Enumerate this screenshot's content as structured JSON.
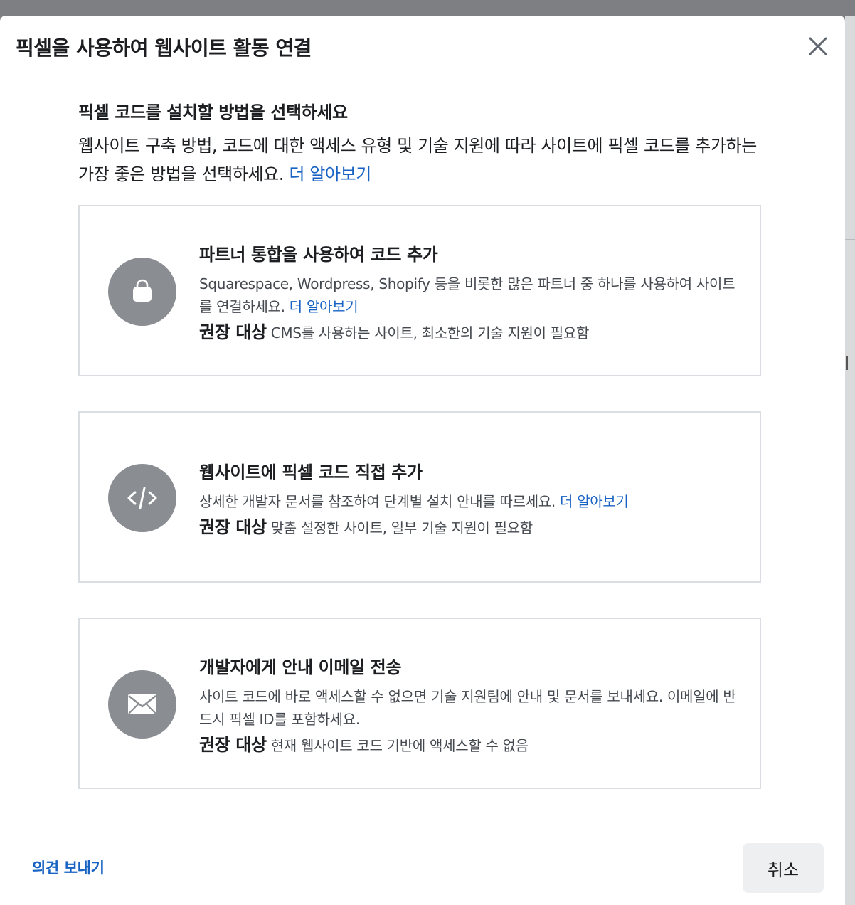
{
  "dialog": {
    "title": "픽셀을 사용하여 웹사이트 활동 연결",
    "close_icon": "close-icon"
  },
  "intro": {
    "heading": "픽셀 코드를 설치할 방법을 선택하세요",
    "description": "웹사이트 구축 방법, 코드에 대한 액세스 유형 및 기술 지원에 따라 사이트에 픽셀 코드를 추가하는 가장 좋은 방법을 선택하세요.",
    "learn_more": "더 알아보기"
  },
  "options": [
    {
      "icon": "shopping-bag-icon",
      "title": "파트너 통합을 사용하여 코드 추가",
      "description": "Squarespace, Wordpress, Shopify 등을 비롯한 많은 파트너 중 하나를 사용하여 사이트를 연결하세요.",
      "learn_more": "더 알아보기",
      "reco_label": "권장 대상",
      "reco_text": "CMS를 사용하는 사이트, 최소한의 기술 지원이 필요함"
    },
    {
      "icon": "code-icon",
      "title": "웹사이트에 픽셀 코드 직접 추가",
      "description": "상세한 개발자 문서를 참조하여 단계별 설치 안내를 따르세요.",
      "learn_more": "더 알아보기",
      "reco_label": "권장 대상",
      "reco_text": "맞춤 설정한 사이트, 일부 기술 지원이 필요함"
    },
    {
      "icon": "envelope-icon",
      "title": "개발자에게 안내 이메일 전송",
      "description": "사이트 코드에 바로 액세스할 수 없으면 기술 지원팀에 안내 및 문서를 보내세요. 이메일에 반드시 픽셀 ID를 포함하세요.",
      "reco_label": "권장 대상",
      "reco_text": "현재 웹사이트 코드 기반에 액세스할 수 없음"
    }
  ],
  "footer": {
    "feedback": "의견 보내기",
    "cancel": "취소"
  },
  "colors": {
    "link": "#1762c3",
    "icon_circle": "#8a8d91",
    "card_border": "#dadde1",
    "cancel_bg": "#eeeff1"
  }
}
